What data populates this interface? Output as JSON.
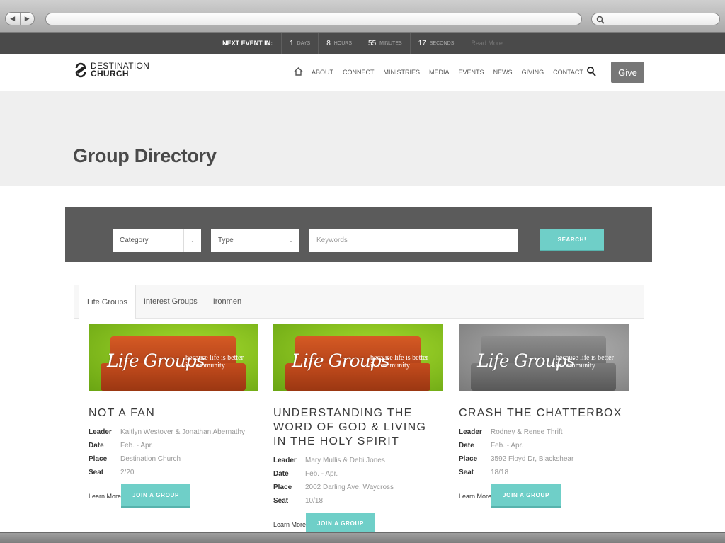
{
  "event_bar": {
    "label": "NEXT EVENT IN:",
    "countdown": [
      {
        "value": "1",
        "unit": "DAYS"
      },
      {
        "value": "8",
        "unit": "HOURS"
      },
      {
        "value": "55",
        "unit": "MINUTES"
      },
      {
        "value": "17",
        "unit": "SECONDS"
      }
    ],
    "read_more": "Read More"
  },
  "header": {
    "logo_line1": "DESTINATION",
    "logo_line2": "CHURCH",
    "nav": [
      "ABOUT",
      "CONNECT",
      "MINISTRIES",
      "MEDIA",
      "EVENTS",
      "NEWS",
      "GIVING",
      "CONTACT"
    ],
    "give_label": "Give"
  },
  "page": {
    "title": "Group Directory"
  },
  "filters": {
    "category": "Category",
    "type": "Type",
    "keywords_placeholder": "Keywords",
    "search_label": "SEARCH!"
  },
  "tabs": [
    "Life Groups",
    "Interest Groups",
    "Ironmen"
  ],
  "image_text": {
    "word": "Life Groups",
    "tag1": "because life is better",
    "tag2": "in community"
  },
  "groups": [
    {
      "title": "NOT A FAN",
      "leader": "Kaitlyn Westover & Jonathan Abernathy",
      "date": "Feb. - Apr.",
      "place": "Destination Church",
      "seat": "2/20",
      "color": "green"
    },
    {
      "title": "UNDERSTANDING THE WORD OF GOD & LIVING IN THE HOLY SPIRIT",
      "leader": "Mary Mullis & Debi Jones",
      "date": "Feb. - Apr.",
      "place": "2002 Darling Ave, Waycross",
      "seat": "10/18",
      "color": "green"
    },
    {
      "title": "CRASH THE CHATTERBOX",
      "leader": "Rodney & Renee Thrift",
      "date": "Feb. - Apr.",
      "place": "3592 Floyd Dr, Blackshear",
      "seat": "18/18",
      "color": "gray"
    }
  ],
  "labels": {
    "leader": "Leader",
    "date": "Date",
    "place": "Place",
    "seat": "Seat",
    "learn_more": "Learn More",
    "join": "JOIN A GROUP"
  },
  "colors": {
    "accent": "#6fcfc8",
    "event_bar": "#4a4a4a",
    "filter_bar": "#5b5b5b"
  }
}
